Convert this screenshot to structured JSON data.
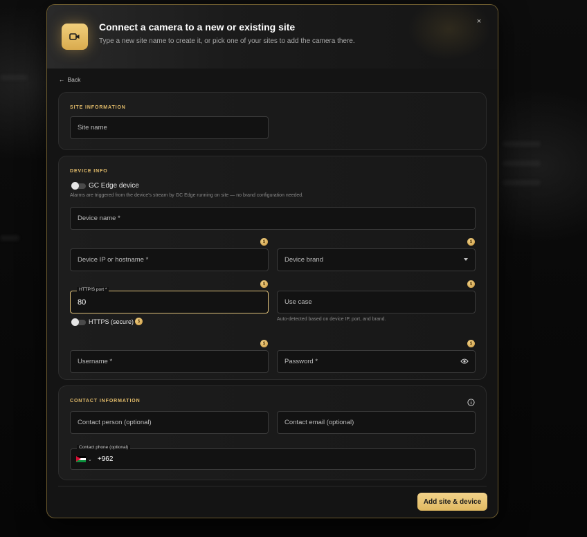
{
  "modal": {
    "title": "Connect a camera to a new or existing site",
    "subtitle": "Type a new site name to create it, or pick one of your sites to add the camera there.",
    "close_label": "×",
    "back_label": "Back"
  },
  "site_info": {
    "section_title": "SITE INFORMATION",
    "site_name_placeholder": "Site name"
  },
  "device_info": {
    "section_title": "DEVICE INFO",
    "gc_edge_label": "GC Edge device",
    "gc_edge_hint": "Alarms are triggered from the device's stream by GC Edge running on site — no brand configuration needed.",
    "device_name_placeholder": "Device name *",
    "device_ip_placeholder": "Device IP or hostname *",
    "device_brand_placeholder": "Device brand",
    "port_label": "HTTP/S port *",
    "port_value": "80",
    "use_case_placeholder": "Use case",
    "https_label": "HTTPS (secure)",
    "use_case_hint": "Auto-detected based on device IP, port, and brand.",
    "username_placeholder": "Username *",
    "password_placeholder": "Password *"
  },
  "contact_info": {
    "section_title": "CONTACT INFORMATION",
    "contact_person_placeholder": "Contact person (optional)",
    "contact_email_placeholder": "Contact email (optional)",
    "phone_label": "Contact phone (optional)",
    "phone_prefix": "+962"
  },
  "footer": {
    "submit_label": "Add site & device"
  },
  "colors": {
    "accent": "#e3bc6a",
    "button": "#e8c471",
    "modal_border": "#6b5a2e"
  }
}
